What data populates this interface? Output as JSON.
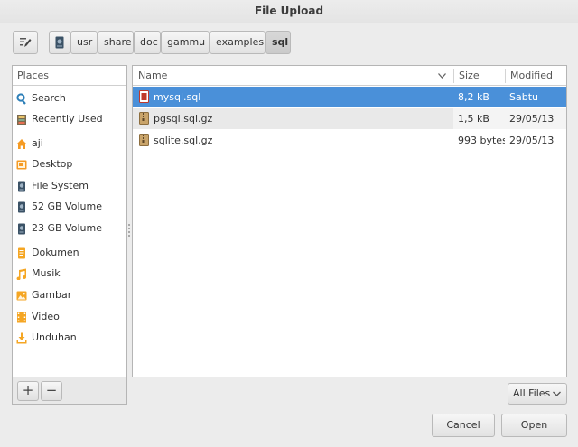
{
  "window": {
    "title": "File Upload"
  },
  "toolbar": {
    "edit_location_icon": "pencil-edit-icon",
    "path": [
      {
        "label": "",
        "icon": "drive-icon"
      },
      {
        "label": "usr"
      },
      {
        "label": "share"
      },
      {
        "label": "doc"
      },
      {
        "label": "gammu"
      },
      {
        "label": "examples"
      },
      {
        "label": "sql",
        "active": true
      }
    ]
  },
  "places": {
    "header": "Places",
    "items": [
      {
        "label": "Search",
        "icon": "search-icon"
      },
      {
        "label": "Recently Used",
        "icon": "recent-icon"
      },
      {
        "label": "aji",
        "icon": "home-icon"
      },
      {
        "label": "Desktop",
        "icon": "desktop-icon"
      },
      {
        "label": "File System",
        "icon": "drive-icon"
      },
      {
        "label": "52 GB Volume",
        "icon": "drive-icon"
      },
      {
        "label": "23 GB Volume",
        "icon": "drive-icon"
      },
      {
        "label": "Dokumen",
        "icon": "documents-folder-icon"
      },
      {
        "label": "Musik",
        "icon": "music-folder-icon"
      },
      {
        "label": "Gambar",
        "icon": "pictures-folder-icon"
      },
      {
        "label": "Video",
        "icon": "video-folder-icon"
      },
      {
        "label": "Unduhan",
        "icon": "downloads-folder-icon"
      }
    ],
    "add_label": "+",
    "remove_label": "−"
  },
  "files": {
    "columns": {
      "name": "Name",
      "size": "Size",
      "modified": "Modified"
    },
    "rows": [
      {
        "name": "mysql.sql",
        "size": "8,2 kB",
        "modified": "Sabtu",
        "icon": "sql-file-icon",
        "selected": true
      },
      {
        "name": "pgsql.sql.gz",
        "size": "1,5 kB",
        "modified": "29/05/13",
        "icon": "archive-file-icon"
      },
      {
        "name": "sqlite.sql.gz",
        "size": "993 bytes",
        "modified": "29/05/13",
        "icon": "archive-file-icon"
      }
    ]
  },
  "filter": {
    "selected": "All Files"
  },
  "actions": {
    "cancel_label": "Cancel",
    "open_label": "Open"
  },
  "colors": {
    "selection": "#4a90d9",
    "home": "#f59b24",
    "folder": "#f5a623",
    "drive": "#3b5266"
  }
}
